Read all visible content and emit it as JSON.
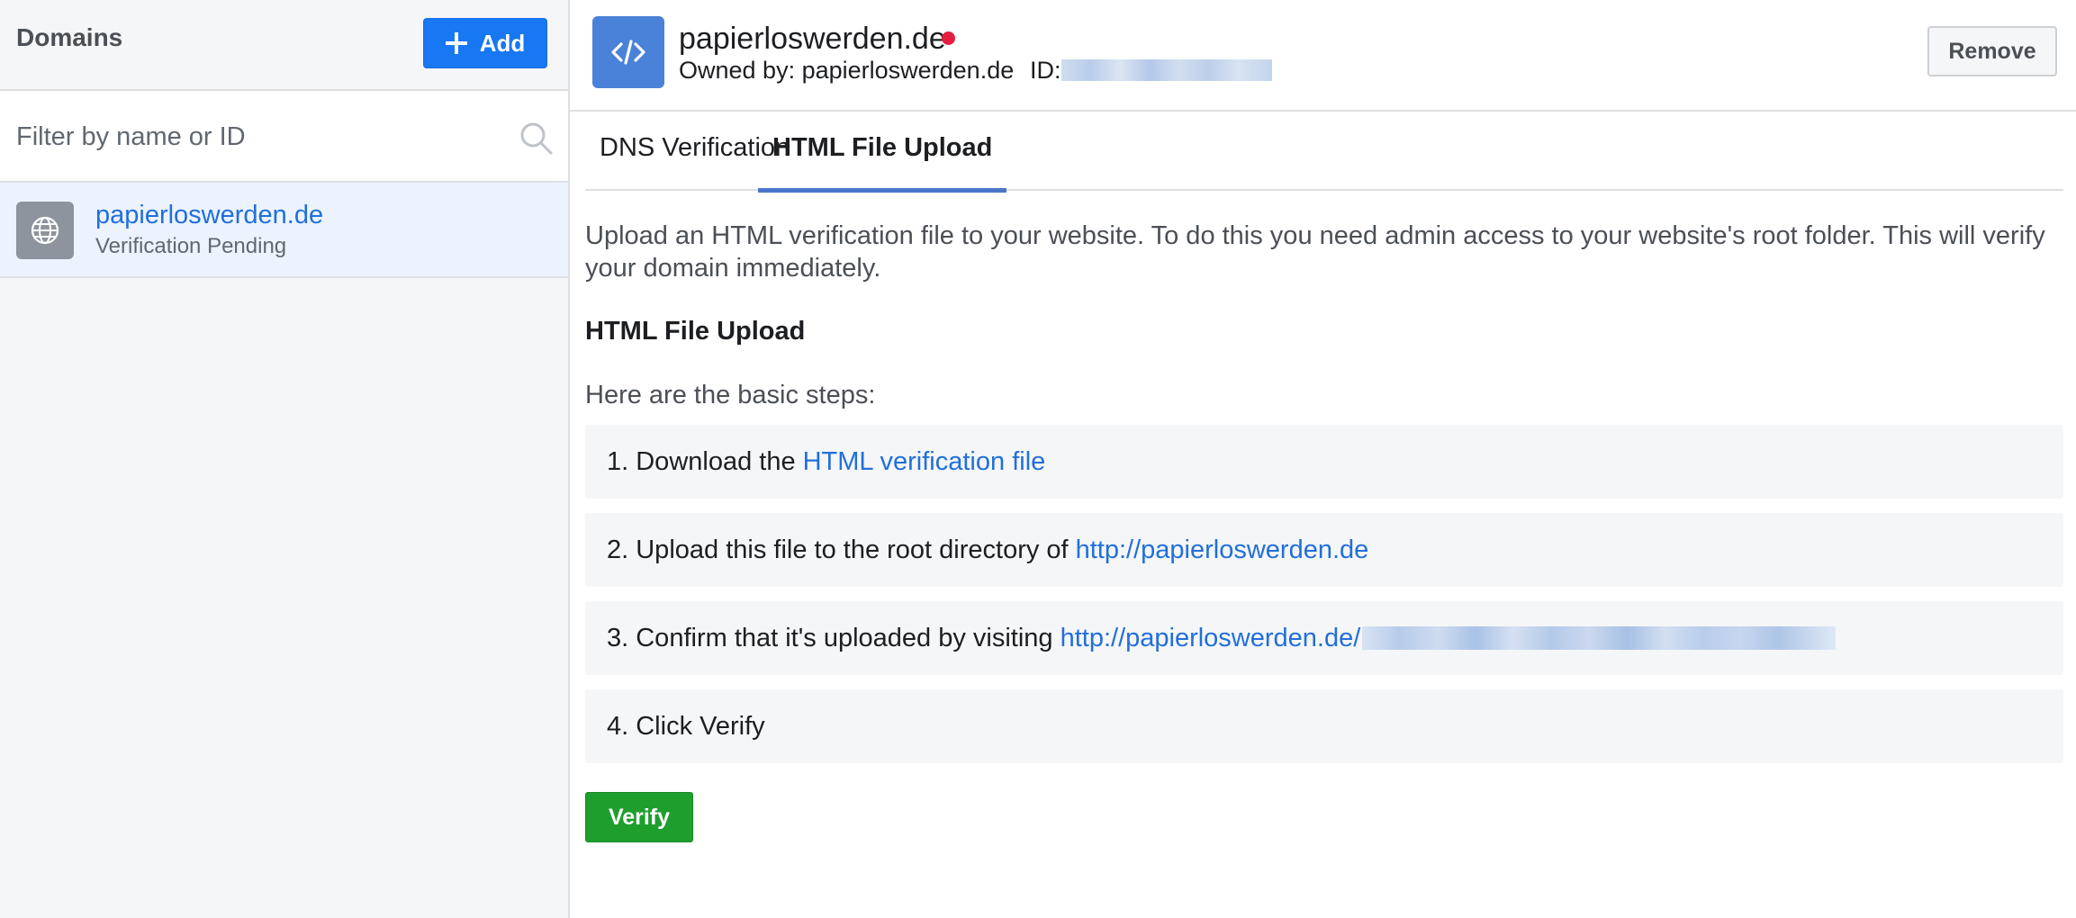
{
  "sidebar": {
    "title": "Domains",
    "add_button": {
      "label": "Add",
      "icon": "plus-icon"
    },
    "filter": {
      "placeholder": "Filter by name or ID",
      "value": "",
      "icon": "search-icon"
    },
    "items": [
      {
        "name": "papierloswerden.de",
        "status": "Verification Pending",
        "icon": "globe-icon",
        "selected": true
      }
    ]
  },
  "header": {
    "icon": "code-icon",
    "title": "papierloswerden.de",
    "status_color": "#e41e3f",
    "owner": "Owned by: papierloswerden.de",
    "id_label": "ID:",
    "id_value_redacted": true,
    "remove_label": "Remove"
  },
  "tabs": [
    {
      "label": "DNS Verification",
      "active": false
    },
    {
      "label": "HTML File Upload",
      "active": true
    }
  ],
  "content": {
    "intro": "Upload an HTML verification file to your website. To do this you need admin access to your website's root folder. This will verify your domain immediately.",
    "heading": "HTML File Upload",
    "steps_intro": "Here are the basic steps:",
    "steps": [
      {
        "text": "1. Download the",
        "link": "HTML verification file"
      },
      {
        "text": "2. Upload this file to the root directory of",
        "link": "http://papierloswerden.de"
      },
      {
        "text": "3. Confirm that it's uploaded by visiting",
        "link": "http://papierloswerden.de/",
        "link_suffix_redacted": true
      },
      {
        "text": "4. Click Verify"
      }
    ],
    "verify_label": "Verify"
  },
  "colors": {
    "accent": "#1877f2",
    "link": "#216fdb",
    "verify": "#1e9e2c",
    "selected_bg": "#ecf3ff"
  }
}
